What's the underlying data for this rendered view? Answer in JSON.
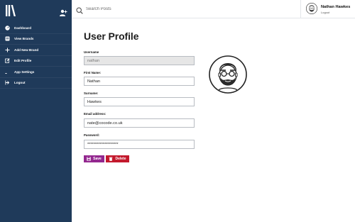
{
  "sidebar": {
    "items": [
      {
        "label": "Dashboard",
        "icon": "dashboard-icon"
      },
      {
        "label": "View Brands",
        "icon": "list-icon"
      },
      {
        "label": "Add New Brand",
        "icon": "plus-icon"
      },
      {
        "label": "Edit Profile",
        "icon": "edit-icon"
      },
      {
        "label": "App Settings",
        "icon": "settings-icon"
      },
      {
        "label": "Logout",
        "icon": "logout-icon"
      }
    ]
  },
  "search": {
    "placeholder": "Search Posts"
  },
  "user": {
    "name": "Nathan Hawkes",
    "logout_label": "Logout"
  },
  "main": {
    "title": "User Profile",
    "fields": {
      "username": {
        "label": "Username",
        "value": "nathan"
      },
      "first_name": {
        "label": "First Name:",
        "value": "Nathan"
      },
      "surname": {
        "label": "Surname:",
        "value": "Hawkes"
      },
      "email": {
        "label": "Email address:",
        "value": "nate@cocode.co.uk"
      },
      "password": {
        "label": "Password:",
        "value": "********************"
      }
    },
    "save_label": "Save",
    "delete_label": "Delete"
  },
  "colors": {
    "sidebar": "#1f3a5a",
    "save": "#93278f",
    "delete": "#c3192d"
  }
}
